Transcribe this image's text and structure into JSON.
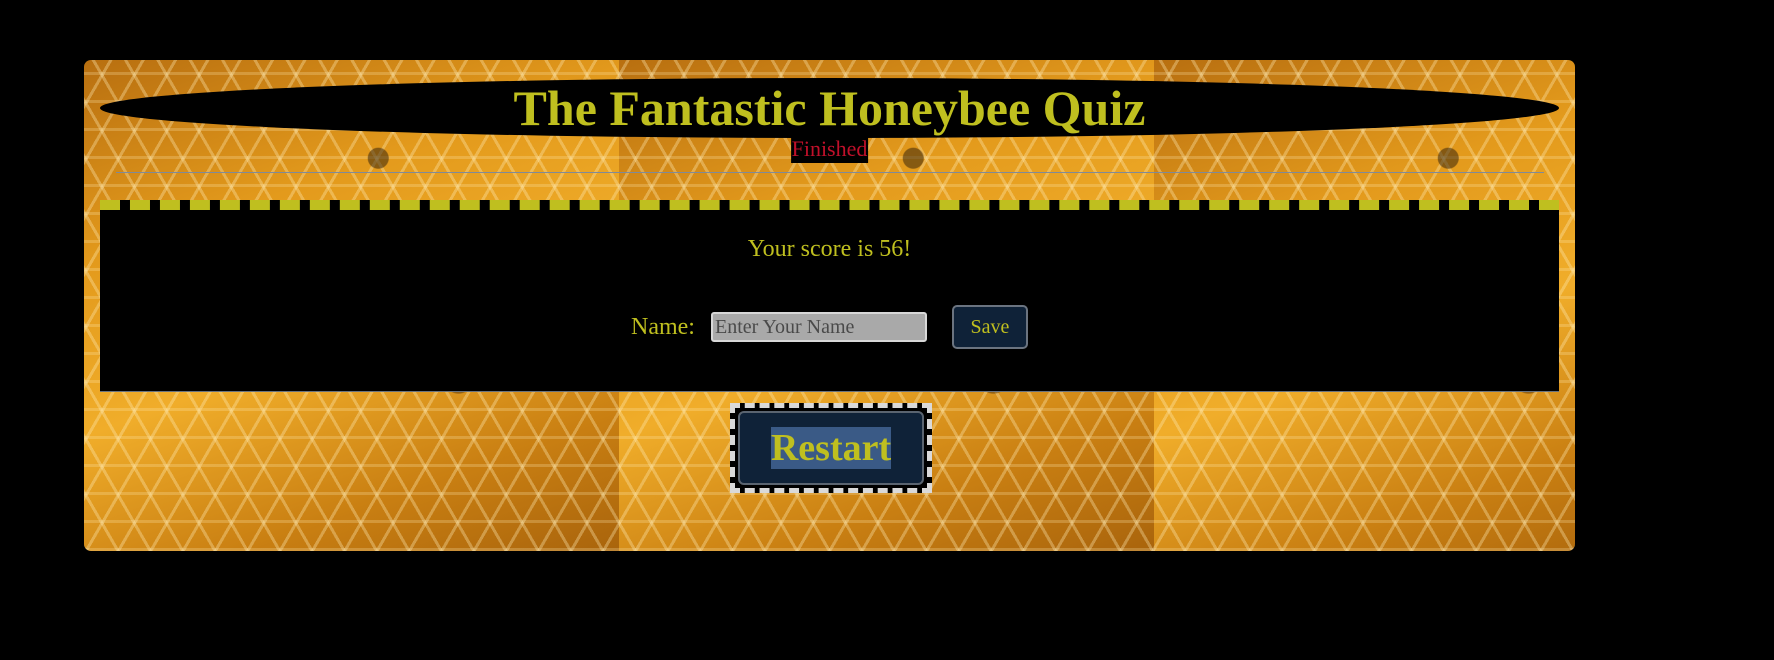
{
  "header": {
    "title": "The Fantastic Honeybee Quiz",
    "status": "Finished"
  },
  "result": {
    "score_text": "Your score is 56!"
  },
  "save_form": {
    "name_label": "Name:",
    "name_placeholder": "Enter Your Name",
    "name_value": "",
    "save_label": "Save"
  },
  "actions": {
    "restart_label": "Restart"
  },
  "colors": {
    "accent": "#bfbf1f",
    "status": "#c0102a",
    "button_bg": "#0f2238"
  }
}
